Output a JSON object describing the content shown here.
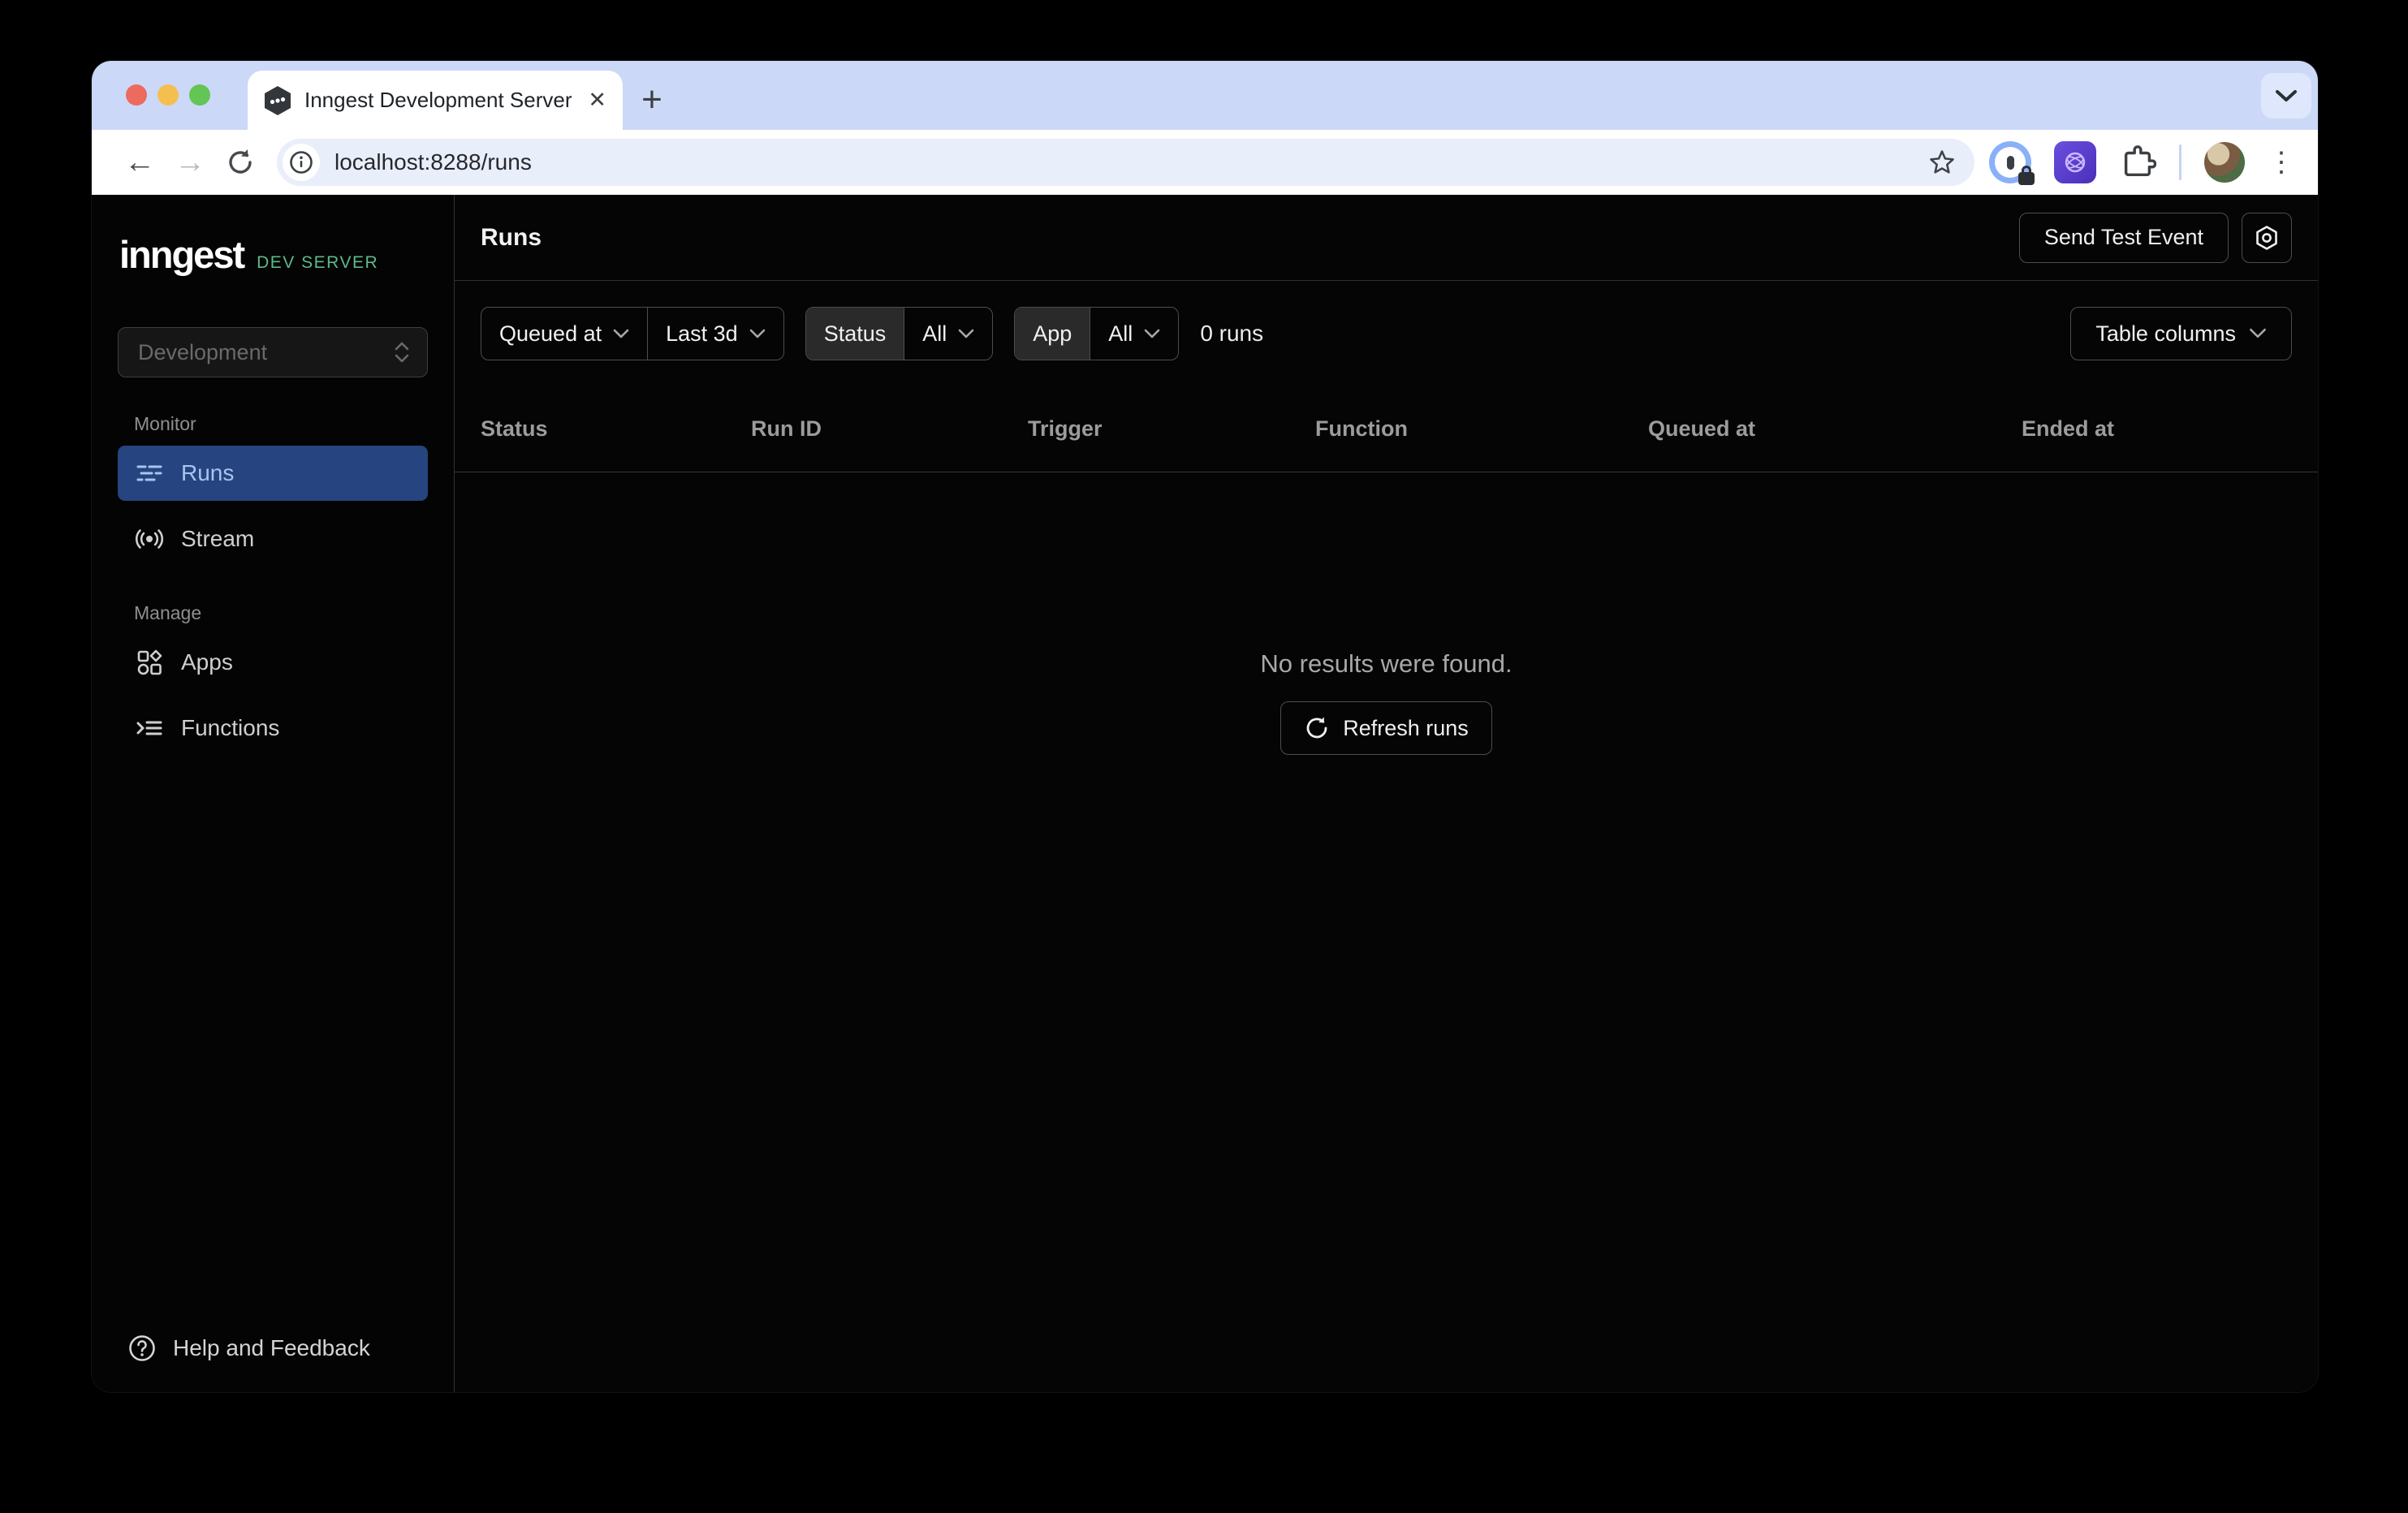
{
  "browser": {
    "tab_title": "Inngest Development Server",
    "url": "localhost:8288/runs",
    "glyphs": {
      "close_tab": "✕",
      "new_tab": "+",
      "back": "←",
      "forward": "→",
      "kebab": "⋮"
    }
  },
  "sidebar": {
    "logo": "inngest",
    "logo_badge": "DEV SERVER",
    "environment": "Development",
    "monitor_label": "Monitor",
    "manage_label": "Manage",
    "nav": [
      {
        "label": "Runs",
        "active": true
      },
      {
        "label": "Stream",
        "active": false
      },
      {
        "label": "Apps",
        "active": false
      },
      {
        "label": "Functions",
        "active": false
      }
    ],
    "help": "Help and Feedback"
  },
  "main": {
    "title": "Runs",
    "send_test_event": "Send Test Event",
    "filters": {
      "queued_at": "Queued at",
      "time_range": "Last 3d",
      "status_label": "Status",
      "status_value": "All",
      "app_label": "App",
      "app_value": "All",
      "runs_count": "0 runs",
      "table_columns": "Table columns"
    },
    "table": {
      "columns": [
        "Status",
        "Run ID",
        "Trigger",
        "Function",
        "Queued at",
        "Ended at"
      ]
    },
    "empty": {
      "message": "No results were found.",
      "refresh": "Refresh runs"
    }
  },
  "colors": {
    "tabstrip": "#ccd8f7",
    "omnibox": "#e9eefb",
    "app_background": "#050505",
    "active_nav_background": "#26447f",
    "active_nav_text": "#a9c4f1",
    "dev_server_green": "#5eb98c",
    "button_border": "#4d4d4d"
  }
}
